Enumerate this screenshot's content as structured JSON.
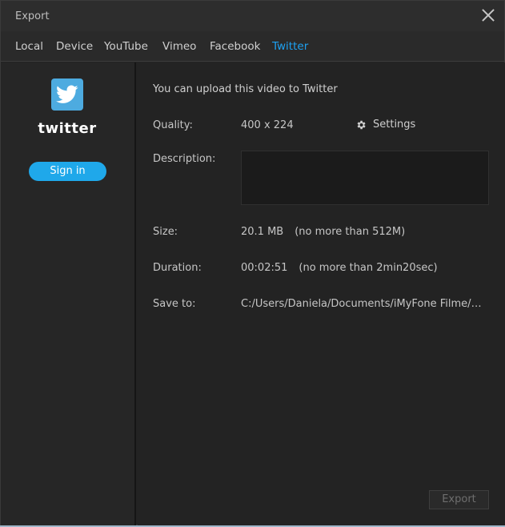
{
  "window": {
    "title": "Export"
  },
  "tabs": [
    {
      "label": "Local",
      "active": false
    },
    {
      "label": "Device",
      "active": false
    },
    {
      "label": "YouTube",
      "active": false
    },
    {
      "label": "Vimeo",
      "active": false
    },
    {
      "label": "Facebook",
      "active": false
    },
    {
      "label": "Twitter",
      "active": true
    }
  ],
  "sidebar": {
    "logo_icon": "twitter-bird-icon",
    "wordmark": "twitter",
    "signin_label": "Sign in"
  },
  "main": {
    "upload_message": "You can upload this video to Twitter",
    "quality": {
      "label": "Quality:",
      "value": "400 x 224"
    },
    "settings": {
      "label": "Settings",
      "icon": "gear-icon"
    },
    "description": {
      "label": "Description:",
      "value": ""
    },
    "size": {
      "label": "Size:",
      "value": "20.1 MB",
      "note": "(no more than 512M)"
    },
    "duration": {
      "label": "Duration:",
      "value": "00:02:51",
      "note": "(no more than 2min20sec)"
    },
    "save_to": {
      "label": "Save to:",
      "value": "C:/Users/Daniela/Documents/iMyFone Filme/Upl..."
    },
    "export_label": "Export"
  },
  "colors": {
    "accent": "#1da1f2",
    "background": "#232323",
    "button_blue": "#1fa8ea"
  }
}
